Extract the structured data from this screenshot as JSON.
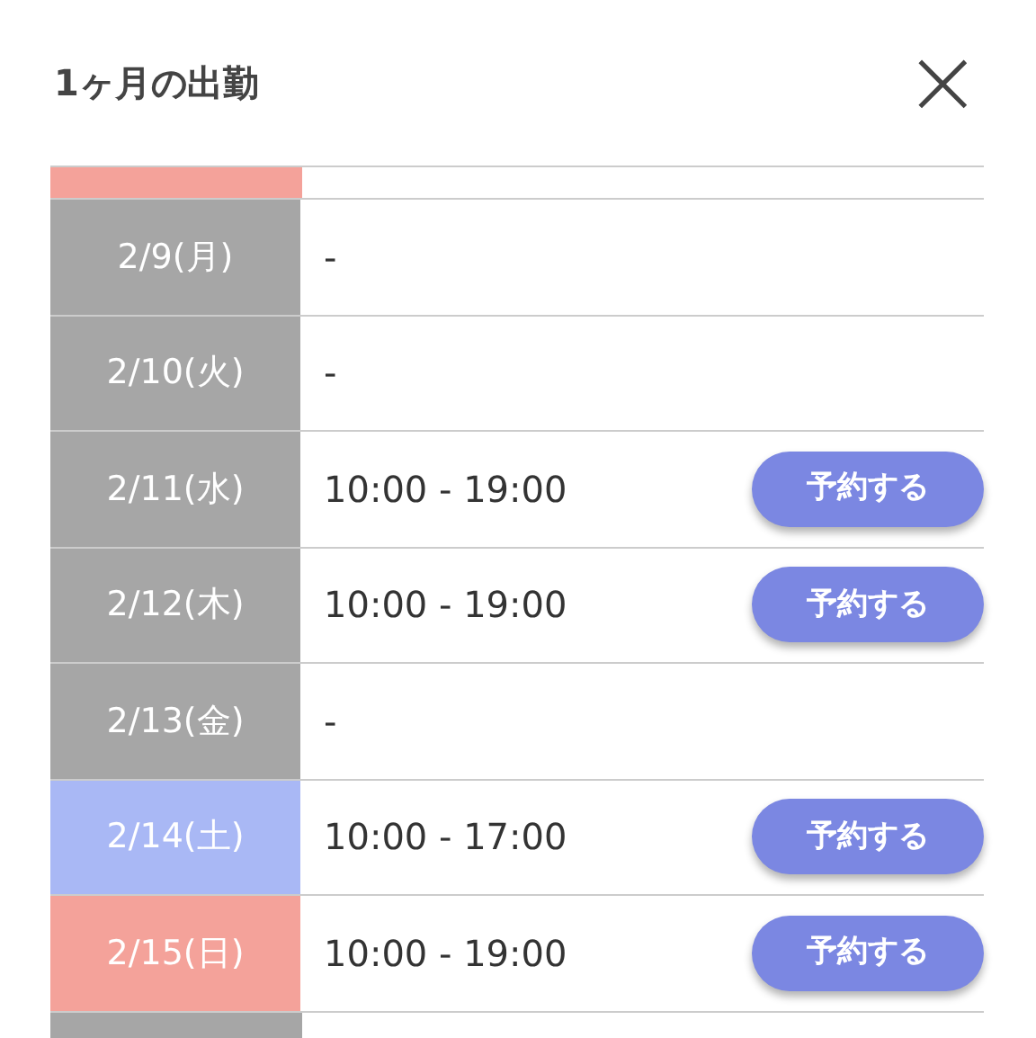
{
  "title": "1ヶ月の出勤",
  "close": "×",
  "top_partial": {
    "color": "#f4a29a"
  },
  "rows": [
    {
      "date": "2/9(月)",
      "hours": "-",
      "color": "#a6a6a6"
    },
    {
      "date": "2/10(火)",
      "hours": "-",
      "color": "#a6a6a6"
    },
    {
      "date": "2/11(水)",
      "hours": "10:00 - 19:00",
      "color": "#a6a6a6",
      "button": "予約する"
    },
    {
      "date": "2/12(木)",
      "hours": "10:00 - 19:00",
      "color": "#a6a6a6",
      "button": "予約する"
    },
    {
      "date": "2/13(金)",
      "hours": "-",
      "color": "#a6a6a6"
    },
    {
      "date": "2/14(土)",
      "hours": "10:00 - 17:00",
      "color": "#a9b8f5",
      "button": "予約する"
    },
    {
      "date": "2/15(日)",
      "hours": "10:00 - 19:00",
      "color": "#f4a29a",
      "button": "予約する"
    }
  ],
  "bottom_partial": {
    "color": "#a6a6a6"
  }
}
